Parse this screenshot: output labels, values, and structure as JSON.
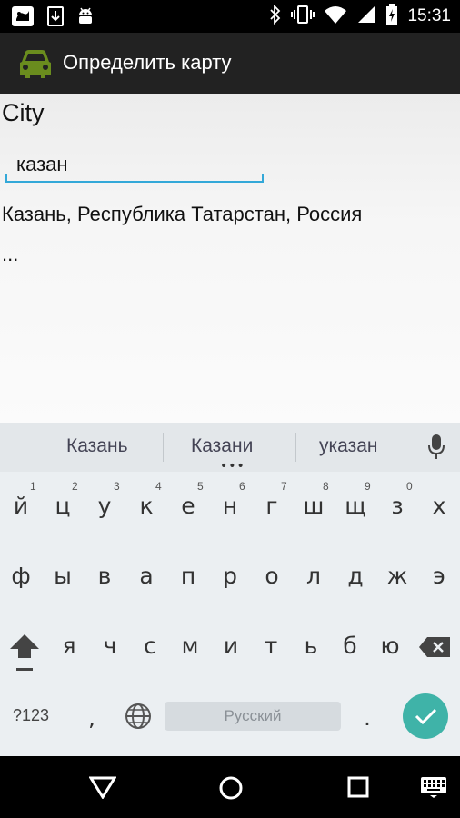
{
  "status_bar": {
    "time": "15:31",
    "left_icons": [
      "notification-app-icon",
      "download-icon",
      "android-icon"
    ],
    "right_icons": [
      "bluetooth-icon",
      "vibrate-icon",
      "wifi-icon",
      "signal-icon",
      "battery-charging-icon"
    ]
  },
  "action_bar": {
    "title": "Определить карту",
    "icon": "car-icon",
    "icon_color": "#6a8c1e"
  },
  "form": {
    "city_label": "City",
    "city_value": "казан",
    "result": "Казань, Республика Татарстан, Россия",
    "more": "..."
  },
  "keyboard": {
    "suggestions": [
      "Казань",
      "Казани",
      "указан"
    ],
    "row1": [
      "й",
      "ц",
      "у",
      "к",
      "е",
      "н",
      "г",
      "ш",
      "щ",
      "з",
      "х"
    ],
    "row1_hints": [
      "1",
      "2",
      "3",
      "4",
      "5",
      "6",
      "7",
      "8",
      "9",
      "0"
    ],
    "row2": [
      "ф",
      "ы",
      "в",
      "а",
      "п",
      "р",
      "о",
      "л",
      "д",
      "ж",
      "э"
    ],
    "row3": [
      "я",
      "ч",
      "с",
      "м",
      "и",
      "т",
      "ь",
      "б",
      "ю"
    ],
    "symbols_label": "?123",
    "comma": ",",
    "period": ".",
    "space_label": "Русский",
    "accent_color": "#3fb3a8"
  },
  "nav": {
    "icons": [
      "back-icon",
      "home-icon",
      "recents-icon",
      "keyboard-switch-icon"
    ]
  }
}
